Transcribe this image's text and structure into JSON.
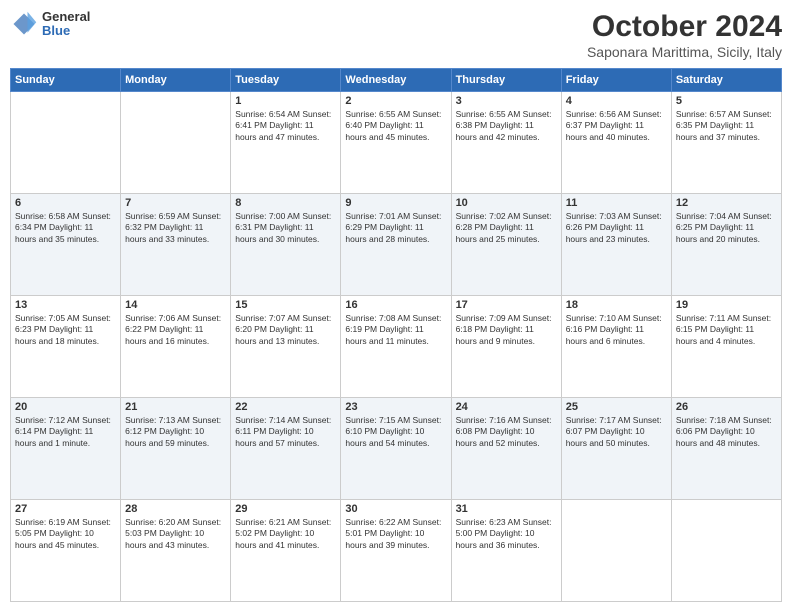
{
  "header": {
    "logo": {
      "general": "General",
      "blue": "Blue"
    },
    "title": "October 2024",
    "subtitle": "Saponara Marittima, Sicily, Italy"
  },
  "days_of_week": [
    "Sunday",
    "Monday",
    "Tuesday",
    "Wednesday",
    "Thursday",
    "Friday",
    "Saturday"
  ],
  "weeks": [
    [
      {
        "day": "",
        "text": ""
      },
      {
        "day": "",
        "text": ""
      },
      {
        "day": "1",
        "text": "Sunrise: 6:54 AM\nSunset: 6:41 PM\nDaylight: 11 hours and 47 minutes."
      },
      {
        "day": "2",
        "text": "Sunrise: 6:55 AM\nSunset: 6:40 PM\nDaylight: 11 hours and 45 minutes."
      },
      {
        "day": "3",
        "text": "Sunrise: 6:55 AM\nSunset: 6:38 PM\nDaylight: 11 hours and 42 minutes."
      },
      {
        "day": "4",
        "text": "Sunrise: 6:56 AM\nSunset: 6:37 PM\nDaylight: 11 hours and 40 minutes."
      },
      {
        "day": "5",
        "text": "Sunrise: 6:57 AM\nSunset: 6:35 PM\nDaylight: 11 hours and 37 minutes."
      }
    ],
    [
      {
        "day": "6",
        "text": "Sunrise: 6:58 AM\nSunset: 6:34 PM\nDaylight: 11 hours and 35 minutes."
      },
      {
        "day": "7",
        "text": "Sunrise: 6:59 AM\nSunset: 6:32 PM\nDaylight: 11 hours and 33 minutes."
      },
      {
        "day": "8",
        "text": "Sunrise: 7:00 AM\nSunset: 6:31 PM\nDaylight: 11 hours and 30 minutes."
      },
      {
        "day": "9",
        "text": "Sunrise: 7:01 AM\nSunset: 6:29 PM\nDaylight: 11 hours and 28 minutes."
      },
      {
        "day": "10",
        "text": "Sunrise: 7:02 AM\nSunset: 6:28 PM\nDaylight: 11 hours and 25 minutes."
      },
      {
        "day": "11",
        "text": "Sunrise: 7:03 AM\nSunset: 6:26 PM\nDaylight: 11 hours and 23 minutes."
      },
      {
        "day": "12",
        "text": "Sunrise: 7:04 AM\nSunset: 6:25 PM\nDaylight: 11 hours and 20 minutes."
      }
    ],
    [
      {
        "day": "13",
        "text": "Sunrise: 7:05 AM\nSunset: 6:23 PM\nDaylight: 11 hours and 18 minutes."
      },
      {
        "day": "14",
        "text": "Sunrise: 7:06 AM\nSunset: 6:22 PM\nDaylight: 11 hours and 16 minutes."
      },
      {
        "day": "15",
        "text": "Sunrise: 7:07 AM\nSunset: 6:20 PM\nDaylight: 11 hours and 13 minutes."
      },
      {
        "day": "16",
        "text": "Sunrise: 7:08 AM\nSunset: 6:19 PM\nDaylight: 11 hours and 11 minutes."
      },
      {
        "day": "17",
        "text": "Sunrise: 7:09 AM\nSunset: 6:18 PM\nDaylight: 11 hours and 9 minutes."
      },
      {
        "day": "18",
        "text": "Sunrise: 7:10 AM\nSunset: 6:16 PM\nDaylight: 11 hours and 6 minutes."
      },
      {
        "day": "19",
        "text": "Sunrise: 7:11 AM\nSunset: 6:15 PM\nDaylight: 11 hours and 4 minutes."
      }
    ],
    [
      {
        "day": "20",
        "text": "Sunrise: 7:12 AM\nSunset: 6:14 PM\nDaylight: 11 hours and 1 minute."
      },
      {
        "day": "21",
        "text": "Sunrise: 7:13 AM\nSunset: 6:12 PM\nDaylight: 10 hours and 59 minutes."
      },
      {
        "day": "22",
        "text": "Sunrise: 7:14 AM\nSunset: 6:11 PM\nDaylight: 10 hours and 57 minutes."
      },
      {
        "day": "23",
        "text": "Sunrise: 7:15 AM\nSunset: 6:10 PM\nDaylight: 10 hours and 54 minutes."
      },
      {
        "day": "24",
        "text": "Sunrise: 7:16 AM\nSunset: 6:08 PM\nDaylight: 10 hours and 52 minutes."
      },
      {
        "day": "25",
        "text": "Sunrise: 7:17 AM\nSunset: 6:07 PM\nDaylight: 10 hours and 50 minutes."
      },
      {
        "day": "26",
        "text": "Sunrise: 7:18 AM\nSunset: 6:06 PM\nDaylight: 10 hours and 48 minutes."
      }
    ],
    [
      {
        "day": "27",
        "text": "Sunrise: 6:19 AM\nSunset: 5:05 PM\nDaylight: 10 hours and 45 minutes."
      },
      {
        "day": "28",
        "text": "Sunrise: 6:20 AM\nSunset: 5:03 PM\nDaylight: 10 hours and 43 minutes."
      },
      {
        "day": "29",
        "text": "Sunrise: 6:21 AM\nSunset: 5:02 PM\nDaylight: 10 hours and 41 minutes."
      },
      {
        "day": "30",
        "text": "Sunrise: 6:22 AM\nSunset: 5:01 PM\nDaylight: 10 hours and 39 minutes."
      },
      {
        "day": "31",
        "text": "Sunrise: 6:23 AM\nSunset: 5:00 PM\nDaylight: 10 hours and 36 minutes."
      },
      {
        "day": "",
        "text": ""
      },
      {
        "day": "",
        "text": ""
      }
    ]
  ]
}
